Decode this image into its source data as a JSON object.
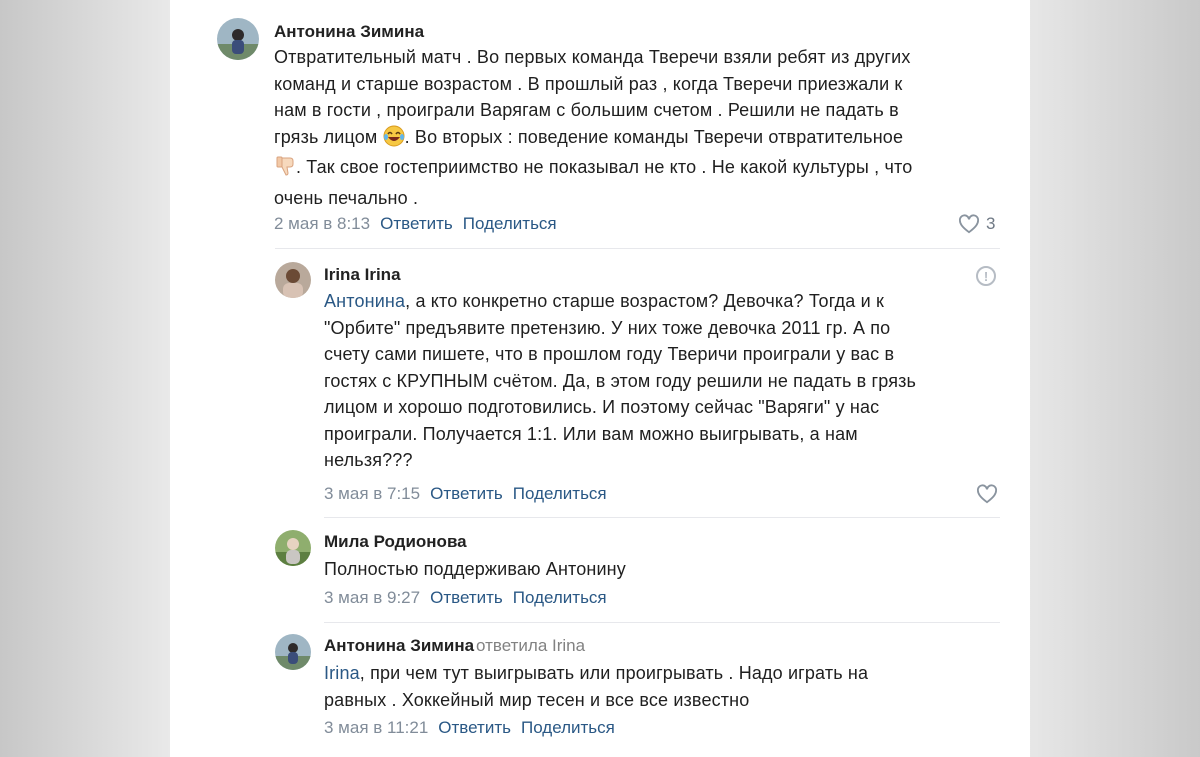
{
  "comments": [
    {
      "author": "Антонина Зимина",
      "lines": [
        "Отвратительный матч . Во первых команда Тверечи взяли ребят из других",
        "команд и старше возрастом . В прошлый раз , когда Тверечи приезжали к",
        "нам в гости , проиграли Варягам с большим счетом . Решили не падать в",
        "грязь лицом",
        ". Во вторых : поведение команды Тверечи отвратительное",
        ". Так свое гостеприимство не показывал не кто . Не какой культуры , что",
        "очень печально ."
      ],
      "emoji_1": "laughing-tears-emoji",
      "emoji_2": "thumbs-down-emoji",
      "date": "2 мая в 8:13",
      "reply": "Ответить",
      "share": "Поделиться",
      "likes": "3"
    },
    {
      "author": "Irina Irina",
      "mention": "Антонина",
      "lines": [
        ", а кто конкретно старше возрастом? Девочка? Тогда и к",
        "\"Орбите\" предъявите претензию. У них тоже девочка 2011 гр. А по",
        "счету сами пишете, что в прошлом году Тверичи проиграли у вас в",
        "гостях с КРУПНЫМ счётом. Да, в этом году решили не падать в грязь",
        "лицом и хорошо подготовились. И поэтому сейчас \"Варяги\" у нас",
        "проиграли. Получается 1:1. Или вам можно выигрывать, а нам",
        "нельзя???"
      ],
      "date": "3 мая в 7:15",
      "reply": "Ответить",
      "share": "Поделиться",
      "report": "!"
    },
    {
      "author": "Мила Родионова",
      "lines": [
        "Полностью поддерживаю Антонину"
      ],
      "date": "3 мая в 9:27",
      "reply": "Ответить",
      "share": "Поделиться"
    },
    {
      "author": "Антонина Зимина",
      "replied_to": "ответила Irina",
      "mention": "Irina",
      "lines": [
        ", при чем тут выигрывать или проигрывать . Надо играть на",
        "равных . Хоккейный мир тесен и все все известно"
      ],
      "date": "3 мая в 11:21",
      "reply": "Ответить",
      "share": "Поделиться"
    }
  ],
  "colors": {
    "link": "#2a5885",
    "meta": "#818c99",
    "text": "#1f1f1f"
  }
}
